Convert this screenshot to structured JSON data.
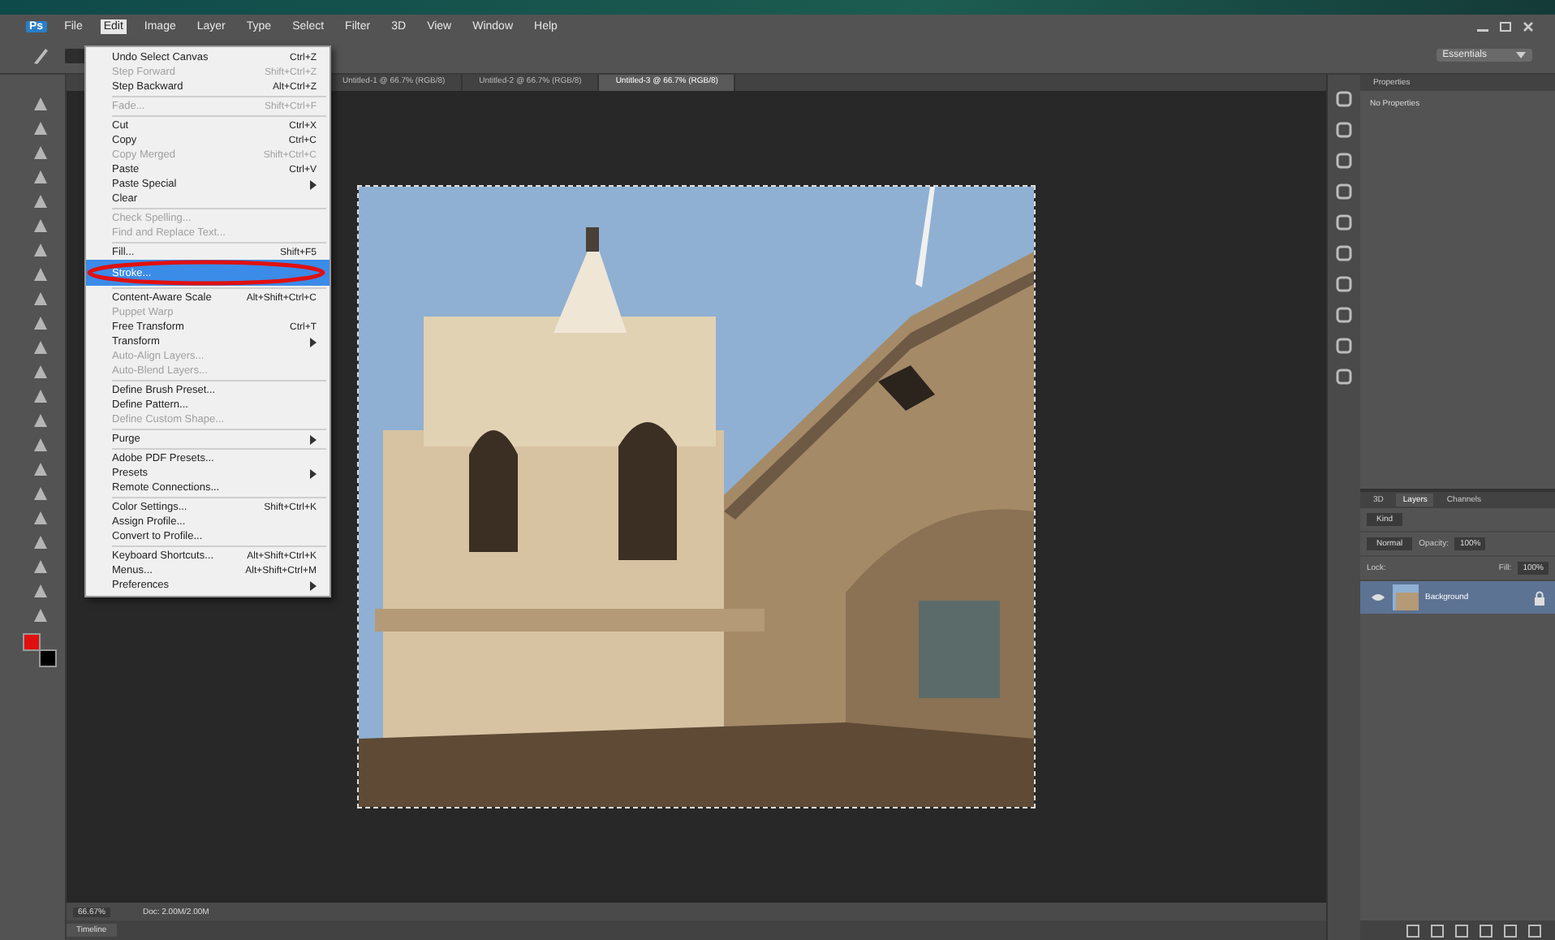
{
  "app": {
    "logo": "Ps"
  },
  "menu_bar": [
    {
      "label": "File",
      "selected": false
    },
    {
      "label": "Edit",
      "selected": true
    },
    {
      "label": "Image",
      "selected": false
    },
    {
      "label": "Layer",
      "selected": false
    },
    {
      "label": "Type",
      "selected": false
    },
    {
      "label": "Select",
      "selected": false
    },
    {
      "label": "Filter",
      "selected": false
    },
    {
      "label": "3D",
      "selected": false
    },
    {
      "label": "View",
      "selected": false
    },
    {
      "label": "Window",
      "selected": false
    },
    {
      "label": "Help",
      "selected": false
    }
  ],
  "workspace": {
    "value": "Essentials"
  },
  "document_tabs": [
    {
      "label": "Untitled-1 @ 66.7% (RGB/8)",
      "selected": false
    },
    {
      "label": "Untitled-2 @ 66.7% (RGB/8)",
      "selected": false
    },
    {
      "label": "Untitled-3 @ 66.7% (RGB/8)",
      "selected": true
    }
  ],
  "edit_menu": [
    {
      "kind": "item",
      "label": "Undo Select Canvas",
      "shortcut": "Ctrl+Z",
      "disabled": false,
      "selected": false,
      "submenu": false,
      "circled": false
    },
    {
      "kind": "item",
      "label": "Step Forward",
      "shortcut": "Shift+Ctrl+Z",
      "disabled": true,
      "selected": false,
      "submenu": false,
      "circled": false
    },
    {
      "kind": "item",
      "label": "Step Backward",
      "shortcut": "Alt+Ctrl+Z",
      "disabled": false,
      "selected": false,
      "submenu": false,
      "circled": false
    },
    {
      "kind": "separator"
    },
    {
      "kind": "item",
      "label": "Fade...",
      "shortcut": "Shift+Ctrl+F",
      "disabled": true,
      "selected": false,
      "submenu": false,
      "circled": false
    },
    {
      "kind": "separator"
    },
    {
      "kind": "item",
      "label": "Cut",
      "shortcut": "Ctrl+X",
      "disabled": false,
      "selected": false,
      "submenu": false,
      "circled": false
    },
    {
      "kind": "item",
      "label": "Copy",
      "shortcut": "Ctrl+C",
      "disabled": false,
      "selected": false,
      "submenu": false,
      "circled": false
    },
    {
      "kind": "item",
      "label": "Copy Merged",
      "shortcut": "Shift+Ctrl+C",
      "disabled": true,
      "selected": false,
      "submenu": false,
      "circled": false
    },
    {
      "kind": "item",
      "label": "Paste",
      "shortcut": "Ctrl+V",
      "disabled": false,
      "selected": false,
      "submenu": false,
      "circled": false
    },
    {
      "kind": "item",
      "label": "Paste Special",
      "disabled": false,
      "selected": false,
      "submenu": true,
      "circled": false
    },
    {
      "kind": "item",
      "label": "Clear",
      "disabled": false,
      "selected": false,
      "submenu": false,
      "circled": false
    },
    {
      "kind": "separator"
    },
    {
      "kind": "item",
      "label": "Check Spelling...",
      "disabled": true,
      "selected": false,
      "submenu": false,
      "circled": false
    },
    {
      "kind": "item",
      "label": "Find and Replace Text...",
      "disabled": true,
      "selected": false,
      "submenu": false,
      "circled": false
    },
    {
      "kind": "separator"
    },
    {
      "kind": "item",
      "label": "Fill...",
      "shortcut": "Shift+F5",
      "disabled": false,
      "selected": false,
      "submenu": false,
      "circled": false
    },
    {
      "kind": "item",
      "label": "Stroke...",
      "disabled": false,
      "selected": true,
      "submenu": false,
      "circled": true
    },
    {
      "kind": "separator"
    },
    {
      "kind": "item",
      "label": "Content-Aware Scale",
      "shortcut": "Alt+Shift+Ctrl+C",
      "disabled": false,
      "selected": false,
      "submenu": false,
      "circled": false
    },
    {
      "kind": "item",
      "label": "Puppet Warp",
      "disabled": true,
      "selected": false,
      "submenu": false,
      "circled": false
    },
    {
      "kind": "item",
      "label": "Free Transform",
      "shortcut": "Ctrl+T",
      "disabled": false,
      "selected": false,
      "submenu": false,
      "circled": false
    },
    {
      "kind": "item",
      "label": "Transform",
      "disabled": false,
      "selected": false,
      "submenu": true,
      "circled": false
    },
    {
      "kind": "item",
      "label": "Auto-Align Layers...",
      "disabled": true,
      "selected": false,
      "submenu": false,
      "circled": false
    },
    {
      "kind": "item",
      "label": "Auto-Blend Layers...",
      "disabled": true,
      "selected": false,
      "submenu": false,
      "circled": false
    },
    {
      "kind": "separator"
    },
    {
      "kind": "item",
      "label": "Define Brush Preset...",
      "disabled": false,
      "selected": false,
      "submenu": false,
      "circled": false
    },
    {
      "kind": "item",
      "label": "Define Pattern...",
      "disabled": false,
      "selected": false,
      "submenu": false,
      "circled": false
    },
    {
      "kind": "item",
      "label": "Define Custom Shape...",
      "disabled": true,
      "selected": false,
      "submenu": false,
      "circled": false
    },
    {
      "kind": "separator"
    },
    {
      "kind": "item",
      "label": "Purge",
      "disabled": false,
      "selected": false,
      "submenu": true,
      "circled": false
    },
    {
      "kind": "separator"
    },
    {
      "kind": "item",
      "label": "Adobe PDF Presets...",
      "disabled": false,
      "selected": false,
      "submenu": false,
      "circled": false
    },
    {
      "kind": "item",
      "label": "Presets",
      "disabled": false,
      "selected": false,
      "submenu": true,
      "circled": false
    },
    {
      "kind": "item",
      "label": "Remote Connections...",
      "disabled": false,
      "selected": false,
      "submenu": false,
      "circled": false
    },
    {
      "kind": "separator"
    },
    {
      "kind": "item",
      "label": "Color Settings...",
      "shortcut": "Shift+Ctrl+K",
      "disabled": false,
      "selected": false,
      "submenu": false,
      "circled": false
    },
    {
      "kind": "item",
      "label": "Assign Profile...",
      "disabled": false,
      "selected": false,
      "submenu": false,
      "circled": false
    },
    {
      "kind": "item",
      "label": "Convert to Profile...",
      "disabled": false,
      "selected": false,
      "submenu": false,
      "circled": false
    },
    {
      "kind": "separator"
    },
    {
      "kind": "item",
      "label": "Keyboard Shortcuts...",
      "shortcut": "Alt+Shift+Ctrl+K",
      "disabled": false,
      "selected": false,
      "submenu": false,
      "circled": false
    },
    {
      "kind": "item",
      "label": "Menus...",
      "shortcut": "Alt+Shift+Ctrl+M",
      "disabled": false,
      "selected": false,
      "submenu": false,
      "circled": false
    },
    {
      "kind": "item",
      "label": "Preferences",
      "disabled": false,
      "selected": false,
      "submenu": true,
      "circled": false
    }
  ],
  "status_bar": {
    "zoom": "66.67%",
    "doc_info": "Doc: 2.00M/2.00M"
  },
  "bottom_panel": {
    "tab": "Timeline"
  },
  "properties_panel": {
    "title": "Properties",
    "message": "No Properties"
  },
  "layers_panel": {
    "tabs": [
      {
        "label": "3D",
        "selected": false
      },
      {
        "label": "Layers",
        "selected": true
      },
      {
        "label": "Channels",
        "selected": false
      }
    ],
    "filter": "Kind",
    "blend_mode": "Normal",
    "opacity_label": "Opacity:",
    "opacity": "100%",
    "lock_label": "Lock:",
    "fill_label": "Fill:",
    "fill": "100%",
    "layers": [
      {
        "name": "Background",
        "selected": true,
        "visible": true,
        "locked": true
      }
    ]
  }
}
